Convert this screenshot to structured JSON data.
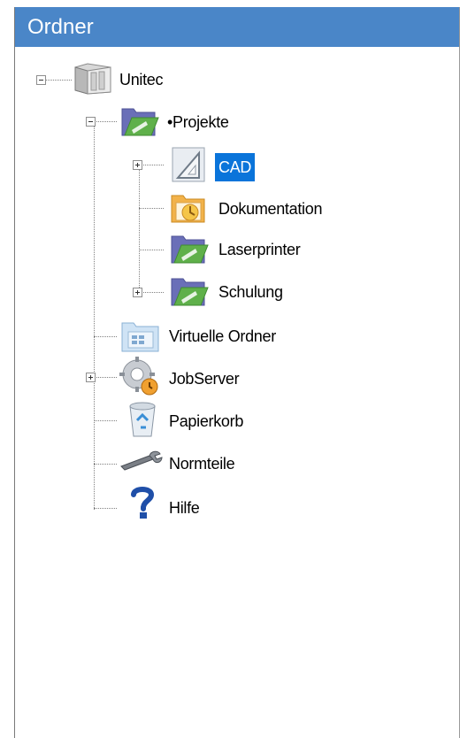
{
  "panel": {
    "title": "Ordner"
  },
  "tree": {
    "root": {
      "label": "Unitec",
      "icon": "server-folder-icon",
      "expanded": true
    },
    "projekte": {
      "label": "•Projekte",
      "icon": "project-folder-icon",
      "expanded": true
    },
    "cad": {
      "label": "CAD",
      "icon": "drawing-triangle-icon",
      "selected": true
    },
    "dokumentation": {
      "label": "Dokumentation",
      "icon": "documentation-folder-icon"
    },
    "laserprinter": {
      "label": "Laserprinter",
      "icon": "project-folder-icon"
    },
    "schulung": {
      "label": "Schulung",
      "icon": "project-folder-icon"
    },
    "virtuelle_ordner": {
      "label": "Virtuelle Ordner",
      "icon": "virtual-folder-icon"
    },
    "jobserver": {
      "label": "JobServer",
      "icon": "job-server-gear-icon"
    },
    "papierkorb": {
      "label": "Papierkorb",
      "icon": "recycle-bin-icon"
    },
    "normteile": {
      "label": "Normteile",
      "icon": "wrench-icon"
    },
    "hilfe": {
      "label": "Hilfe",
      "icon": "help-question-icon"
    }
  },
  "colors": {
    "header": "#4a86c8",
    "selection": "#0a74da",
    "folder_green": "#5fb04a",
    "folder_purple": "#6a6fb8"
  }
}
